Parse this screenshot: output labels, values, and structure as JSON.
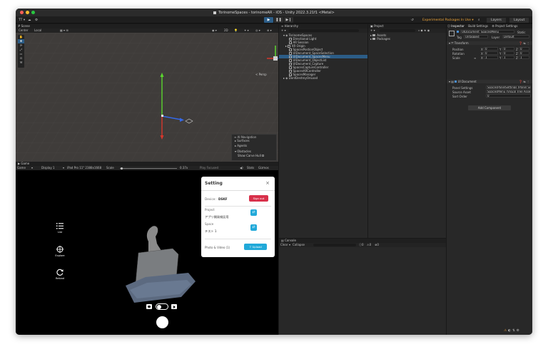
{
  "window": {
    "title": "TorinomeSpaces - torinomeAR - iOS - Unity 2022.3.21f1 <Metal>"
  },
  "toolbar": {
    "account": "TT ▾",
    "packages_notice": "Experimental Packages In Use ▾",
    "layers": "Layers",
    "layout": "Layout"
  },
  "scene": {
    "tab": "Scene",
    "pivot": "Center",
    "space": "Local",
    "persp_label": "< Persp",
    "overlay": {
      "title": "AI Navigation",
      "items": [
        "Surfaces",
        "Agents",
        "Obstacles"
      ],
      "checkbox": "Show Carve Hull"
    },
    "colors": {
      "grid_bg": "#403d3b",
      "axis_y": "#5bd52f",
      "axis_x": "#d6372d",
      "axis_z": "#3569e8"
    }
  },
  "game": {
    "tab": "Game",
    "mode": "Game",
    "display": "Display 1",
    "device": "iPad Pro 11\" 2388x1668",
    "scale_label": "Scale",
    "scale_value": "0.37x",
    "focused": "Play Focused",
    "stats": "Stats",
    "gizmos": "Gizmos",
    "side_buttons": [
      {
        "icon": "list-icon",
        "label": "List"
      },
      {
        "icon": "explore-icon",
        "label": "Explore"
      },
      {
        "icon": "reload-icon",
        "label": "Reload"
      }
    ]
  },
  "settings": {
    "title": "Setting",
    "device_label": "Device:",
    "device_value": "DSKF",
    "signout": "Sign out",
    "project_label": "Project",
    "project_value": "アプリ開発検証用",
    "space_label": "Space",
    "space_value": "テスト 1",
    "photo_label": "Photo & Video (1)",
    "upload": "Upload",
    "colors": {
      "signout": "#d8304a",
      "accent": "#21a9d9"
    }
  },
  "hierarchy": {
    "tab": "Hierarchy",
    "root": "TorinomeSpaces",
    "items": [
      "Directional Light",
      "AR Session",
      "XR Origin",
      "SpacesPostionObject",
      "UIDocument_SpaceSelection",
      "UIDocument_SpacesMenu",
      "UIDocument_ObjectList",
      "UIDocument_Capture",
      "SpacesCaptureController",
      "SpacesARController",
      "SpacesManager"
    ],
    "selected_index": 5,
    "dontdestroy": "DontDestroyOnLoad"
  },
  "project": {
    "tab": "Project",
    "folders": [
      "Assets",
      "Packages"
    ]
  },
  "console": {
    "tab": "Console",
    "clear": "Clear",
    "collapse": "Collapse",
    "counts": {
      "log": "0",
      "warn": "0",
      "error": "0"
    }
  },
  "inspector": {
    "tabs": [
      "Inspector",
      "Build Settings",
      "Project Settings"
    ],
    "object_name": "UIDocument_SpacesMenu",
    "static": "Static",
    "tag_label": "Tag",
    "tag_value": "Untagged",
    "layer_label": "Layer",
    "layer_value": "Default",
    "transform": {
      "header": "Transform",
      "rows": [
        {
          "label": "Position",
          "x": "0",
          "y": "0",
          "z": "0"
        },
        {
          "label": "Rotation",
          "x": "0",
          "y": "0",
          "z": "0"
        },
        {
          "label": "Scale",
          "x": "1",
          "y": "1",
          "z": "1"
        }
      ]
    },
    "uidocument": {
      "header": "UI Document",
      "rows": [
        {
          "label": "Panel Settings",
          "value": "SpacesPanelSettings (Panel Settin"
        },
        {
          "label": "Source Asset",
          "value": "SpacesMenu (Visual Tree Asset)"
        },
        {
          "label": "Sort Order",
          "value": "0"
        }
      ]
    },
    "add_component": "Add Component"
  }
}
